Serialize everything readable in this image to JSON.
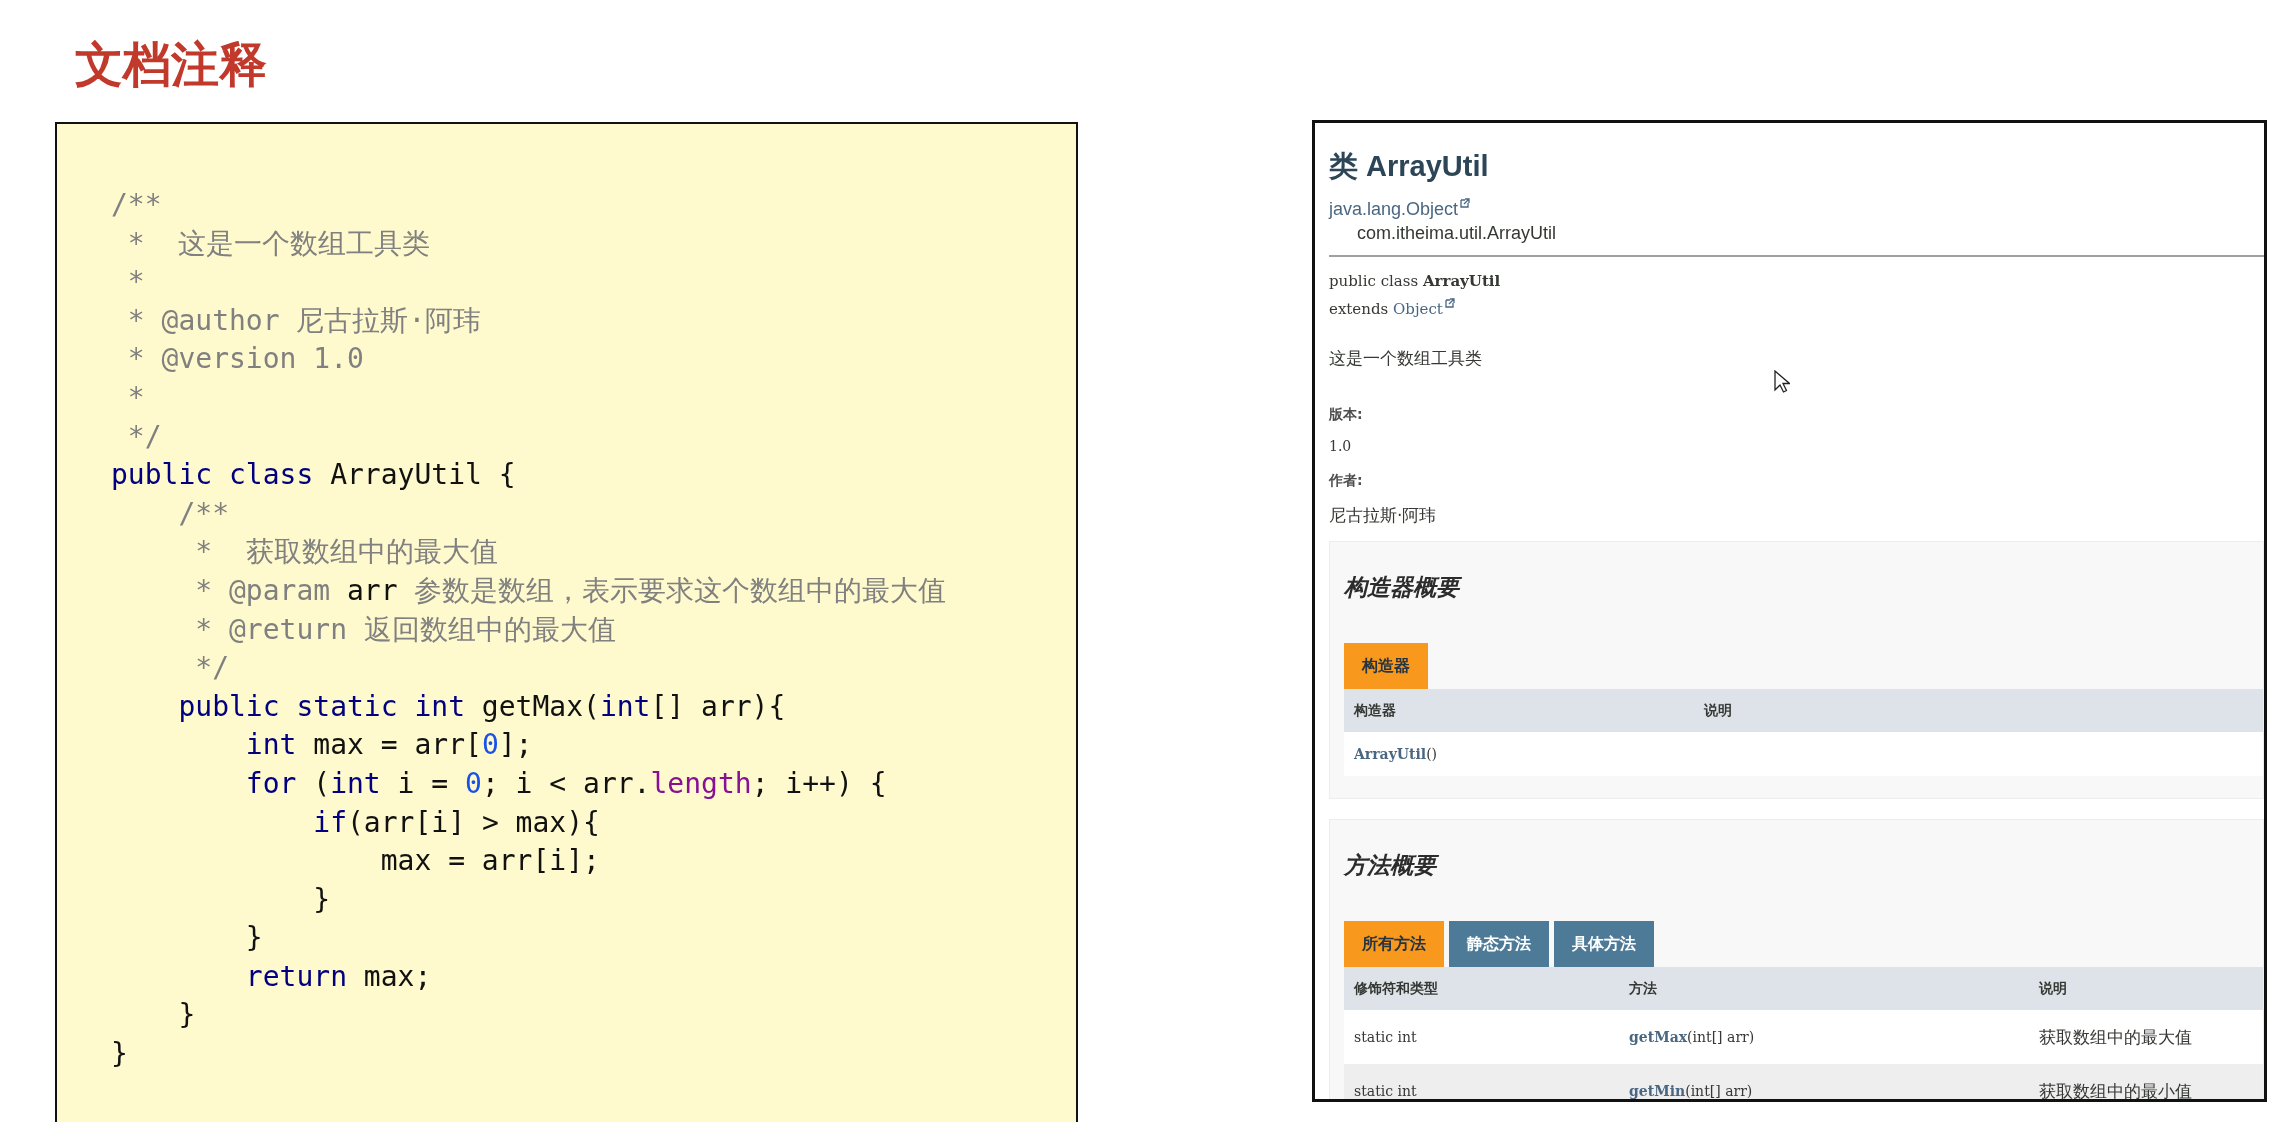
{
  "slide_title": "文档注释",
  "code_lines": [
    [
      {
        "kind": "comment",
        "text": "/**"
      }
    ],
    [
      {
        "kind": "comment",
        "text": " *  这是一个数组工具类"
      }
    ],
    [
      {
        "kind": "comment",
        "text": " *"
      }
    ],
    [
      {
        "kind": "comment",
        "text": " * @author 尼古拉斯·阿玮"
      }
    ],
    [
      {
        "kind": "comment",
        "text": " * @version 1.0"
      }
    ],
    [
      {
        "kind": "comment",
        "text": " *"
      }
    ],
    [
      {
        "kind": "comment",
        "text": " */"
      }
    ],
    [
      {
        "kind": "keyword",
        "text": "public class"
      },
      {
        "kind": "plain",
        "text": " ArrayUtil {"
      }
    ],
    [
      {
        "kind": "comment",
        "text": "    /**"
      }
    ],
    [
      {
        "kind": "comment",
        "text": "     *  获取数组中的最大值"
      }
    ],
    [
      {
        "kind": "comment",
        "text": "     * @param "
      },
      {
        "kind": "plain",
        "text": "arr"
      },
      {
        "kind": "comment",
        "text": " 参数是数组，表示要求这个数组中的最大值"
      }
    ],
    [
      {
        "kind": "comment",
        "text": "     * @return 返回数组中的最大值"
      }
    ],
    [
      {
        "kind": "comment",
        "text": "     */"
      }
    ],
    [
      {
        "kind": "keyword",
        "text": "    public static int"
      },
      {
        "kind": "plain",
        "text": " getMax("
      },
      {
        "kind": "keyword",
        "text": "int"
      },
      {
        "kind": "plain",
        "text": "[] arr){"
      }
    ],
    [
      {
        "kind": "keyword",
        "text": "        int"
      },
      {
        "kind": "plain",
        "text": " max = arr["
      },
      {
        "kind": "number",
        "text": "0"
      },
      {
        "kind": "plain",
        "text": "];"
      }
    ],
    [
      {
        "kind": "keyword",
        "text": "        for"
      },
      {
        "kind": "plain",
        "text": " ("
      },
      {
        "kind": "keyword",
        "text": "int"
      },
      {
        "kind": "plain",
        "text": " i = "
      },
      {
        "kind": "number",
        "text": "0"
      },
      {
        "kind": "plain",
        "text": "; i < arr."
      },
      {
        "kind": "field",
        "text": "length"
      },
      {
        "kind": "plain",
        "text": "; i++) {"
      }
    ],
    [
      {
        "kind": "keyword",
        "text": "            if"
      },
      {
        "kind": "plain",
        "text": "(arr[i] > max){"
      }
    ],
    [
      {
        "kind": "plain",
        "text": "                max = arr[i];"
      }
    ],
    [
      {
        "kind": "plain",
        "text": "            }"
      }
    ],
    [
      {
        "kind": "plain",
        "text": "        }"
      }
    ],
    [
      {
        "kind": "keyword",
        "text": "        return"
      },
      {
        "kind": "plain",
        "text": " max;"
      }
    ],
    [
      {
        "kind": "plain",
        "text": "    }"
      }
    ],
    [
      {
        "kind": "plain",
        "text": "}"
      }
    ]
  ],
  "javadoc": {
    "title": "类 ArrayUtil",
    "superclass_link": "java.lang.Object",
    "class_path": "com.itheima.util.ArrayUtil",
    "declaration": {
      "prefix": "public class ",
      "name": "ArrayUtil",
      "extends": "extends ",
      "extends_link": "Object"
    },
    "description": "这是一个数组工具类",
    "version_label": "版本:",
    "version": "1.0",
    "author_label": "作者:",
    "author": "尼古拉斯·阿玮",
    "constructor_summary": {
      "heading": "构造器概要",
      "tabs": [
        {
          "label": "构造器",
          "selected": true
        }
      ],
      "columns": [
        "构造器",
        "说明"
      ],
      "rows": [
        {
          "name": "ArrayUtil",
          "params": "()"
        }
      ]
    },
    "method_summary": {
      "heading": "方法概要",
      "tabs": [
        {
          "label": "所有方法",
          "selected": true
        },
        {
          "label": "静态方法",
          "selected": false
        },
        {
          "label": "具体方法",
          "selected": false
        }
      ],
      "columns": [
        "修饰符和类型",
        "方法",
        "说明"
      ],
      "rows": [
        {
          "modifier": "static int",
          "name": "getMax",
          "params": "(int[] arr)",
          "description": "获取数组中的最大值"
        },
        {
          "modifier": "static int",
          "name": "getMin",
          "params": "(int[] arr)",
          "description": "获取数组中的最小值"
        }
      ]
    }
  }
}
